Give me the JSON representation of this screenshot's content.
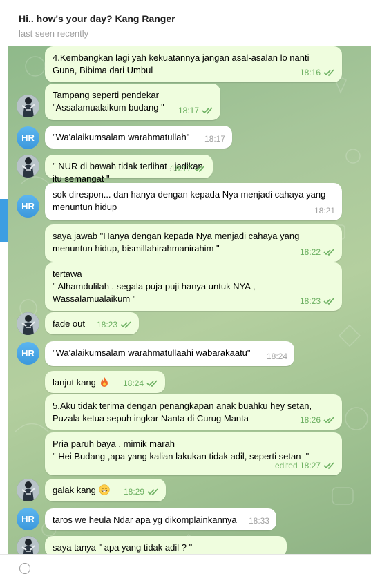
{
  "header": {
    "title": "Hi.. how's your day? Kang Ranger",
    "status": "last seen recently"
  },
  "colors": {
    "outgoing_bubble": "#effdde",
    "incoming_bubble": "#ffffff",
    "time_outgoing": "#6cb061",
    "time_incoming": "#a2a2a2",
    "avatar_hr": "#4aa8e8",
    "side_strip": "#3d9ee2"
  },
  "avatar_initials": "HR",
  "messages": [
    {
      "id": "m1",
      "text": "4.Kembangkan lagi yah kekuatannya jangan asal-asalan lo nanti\nGuna, Bibima dari Umbul",
      "time": "18:16",
      "outgoing": true
    },
    {
      "id": "m2",
      "text": "Tampang seperti pendekar\n\"Assalamualaikum budang \"",
      "time": "18:17",
      "outgoing": true
    },
    {
      "id": "m3",
      "text": "\"Wa'alaikumsalam warahmatullah\"",
      "time": "18:17",
      "outgoing": false
    },
    {
      "id": "m4",
      "text": "\" NUR di bawah tidak terlihat , jadikan itu semangat \"",
      "time": "18:17",
      "outgoing": true
    },
    {
      "id": "m5",
      "text": "sok direspon... dan hanya dengan kepada Nya menjadi cahaya yang\nmenuntun hidup",
      "time": "18:21",
      "outgoing": false
    },
    {
      "id": "m6",
      "text": "saya jawab \"Hanya dengan kepada Nya menjadi cahaya yang\nmenuntun hidup, bismillahirahmanirahim \"",
      "time": "18:22",
      "outgoing": true
    },
    {
      "id": "m7",
      "text": "tertawa\n\" Alhamdulilah . segala puja puji hanya untuk NYA ,\nWassalamualaikum \"",
      "time": "18:23",
      "outgoing": true
    },
    {
      "id": "m8",
      "text": "fade out",
      "time": "18:23",
      "outgoing": true
    },
    {
      "id": "m9",
      "text": "\"Wa'alaikumsalam warahmatullaahi wabarakaatu\"",
      "time": "18:24",
      "outgoing": false
    },
    {
      "id": "m10",
      "text": "lanjut kang",
      "time": "18:24",
      "outgoing": true,
      "emoji": "fire"
    },
    {
      "id": "m11",
      "text": "5.Aku tidak terima dengan penangkapan anak buahku hey setan,\nPuzala ketua sepuh ingkar Nanta di Curug Manta",
      "time": "18:26",
      "outgoing": true
    },
    {
      "id": "m12",
      "text": "Pria paruh baya , mimik marah\n\" Hei Budang ,apa yang kalian lakukan tidak adil, seperti setan  \"",
      "time": "edited 18:27",
      "outgoing": true
    },
    {
      "id": "m13",
      "text": "galak kang",
      "time": "18:29",
      "outgoing": true,
      "emoji": "grin"
    },
    {
      "id": "m14",
      "text": "taros we heula Ndar apa yg dikomplainkannya",
      "time": "18:33",
      "outgoing": false
    },
    {
      "id": "m15",
      "text": "saya tanya \" apa yang tidak adil ? \"",
      "time": "",
      "outgoing": true
    }
  ]
}
